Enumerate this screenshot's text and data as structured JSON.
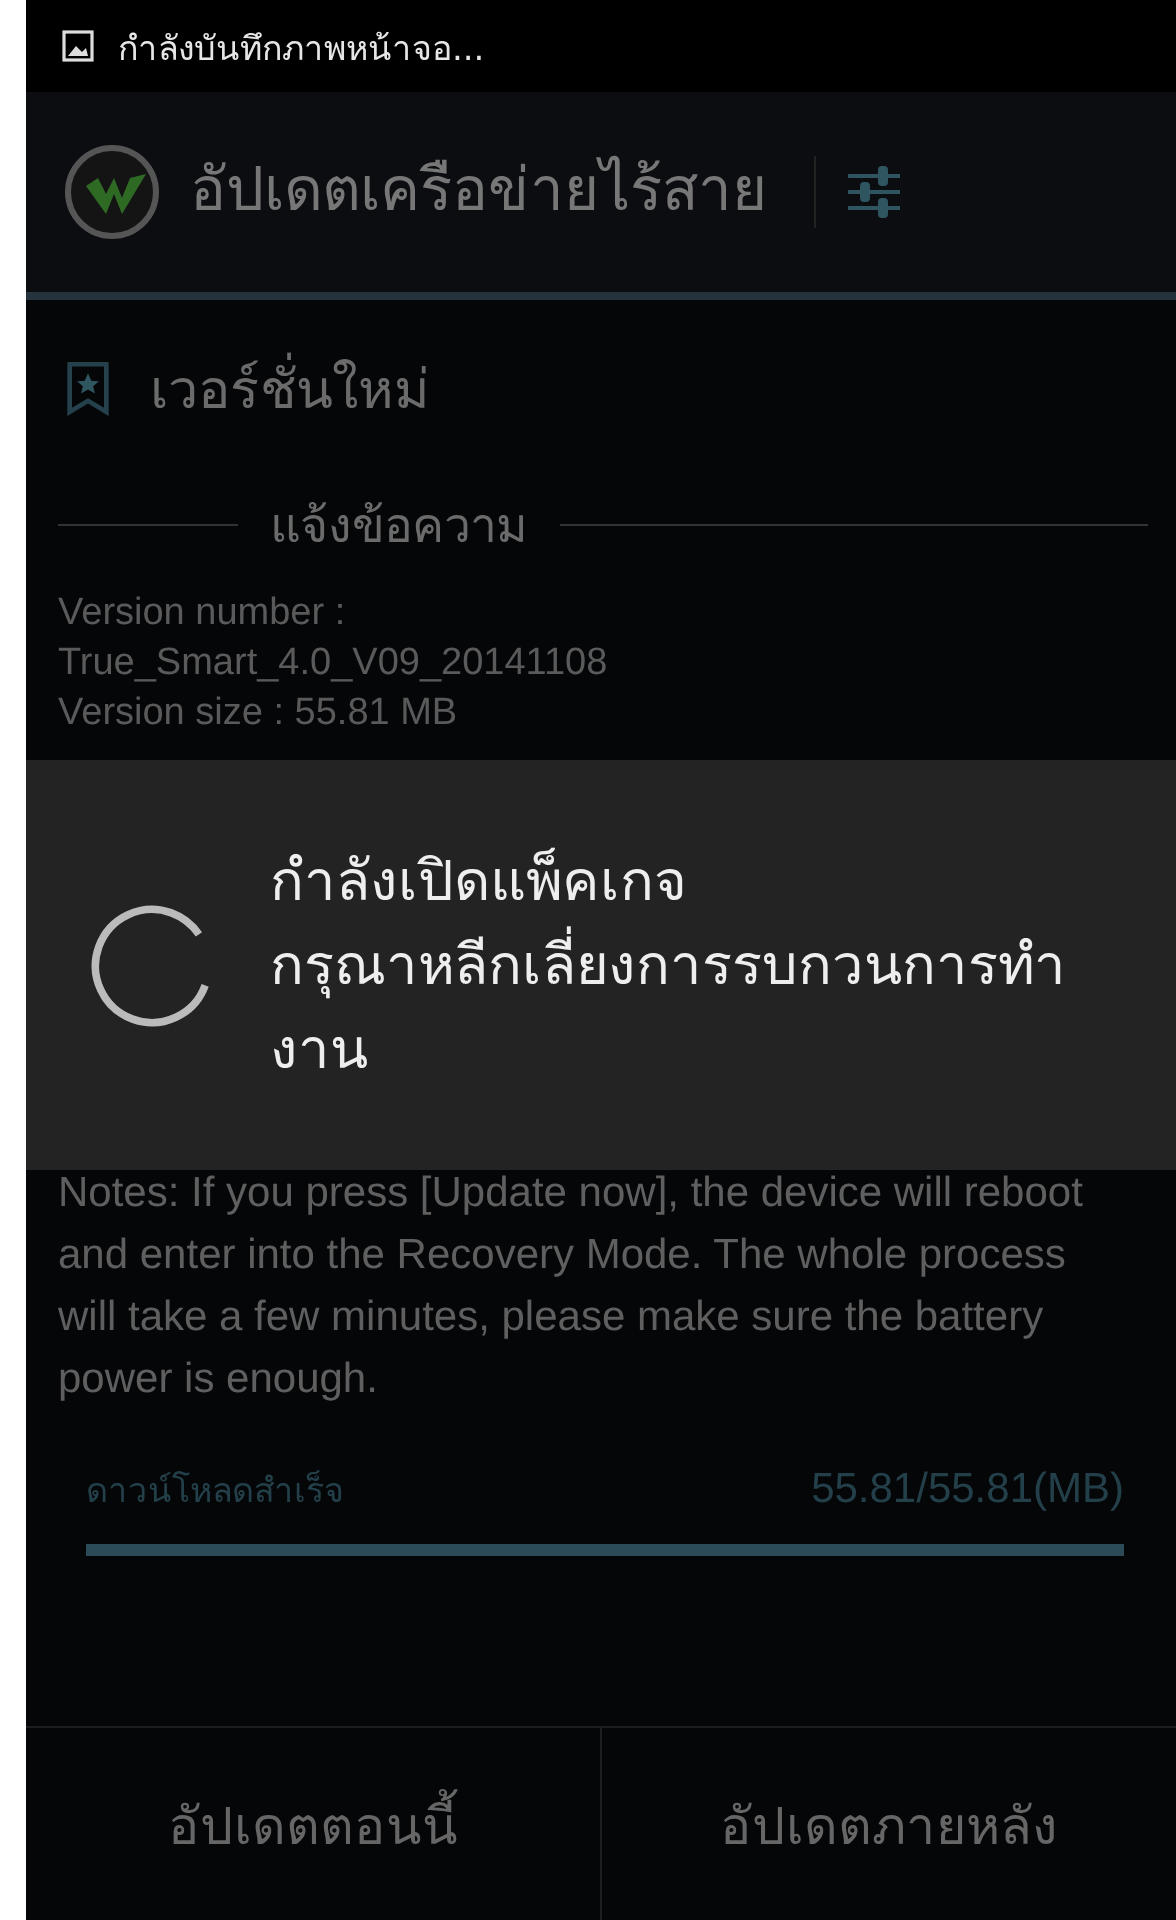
{
  "status_bar": {
    "notification": "กำลังบันทึกภาพหน้าจอ..."
  },
  "action_bar": {
    "title": "อัปเดตเครือข่ายไร้สาย"
  },
  "section": {
    "title": "เวอร์ชั่นใหม่",
    "subheading": "แจ้งข้อความ"
  },
  "details": [
    "Version number :",
    "True_Smart_4.0_V09_20141108",
    "Version size : 55.81 MB"
  ],
  "notes": "Notes: If you press [Update now], the device will reboot and enter into the Recovery Mode. The whole process will take a few minutes, please make sure the battery power is enough.",
  "download": {
    "label": "ดาวน์โหลดสำเร็จ",
    "reading": "55.81/55.81(MB)",
    "level": 1
  },
  "buttons": [
    "อัปเดตตอนนี้",
    "อัปเดตภายหลัง"
  ],
  "dialog": {
    "lines": [
      "กำลังเปิดแพ็คเกจ",
      "กรุณาหลีกเลี่ยงการรบกวนการทำงาน"
    ]
  }
}
